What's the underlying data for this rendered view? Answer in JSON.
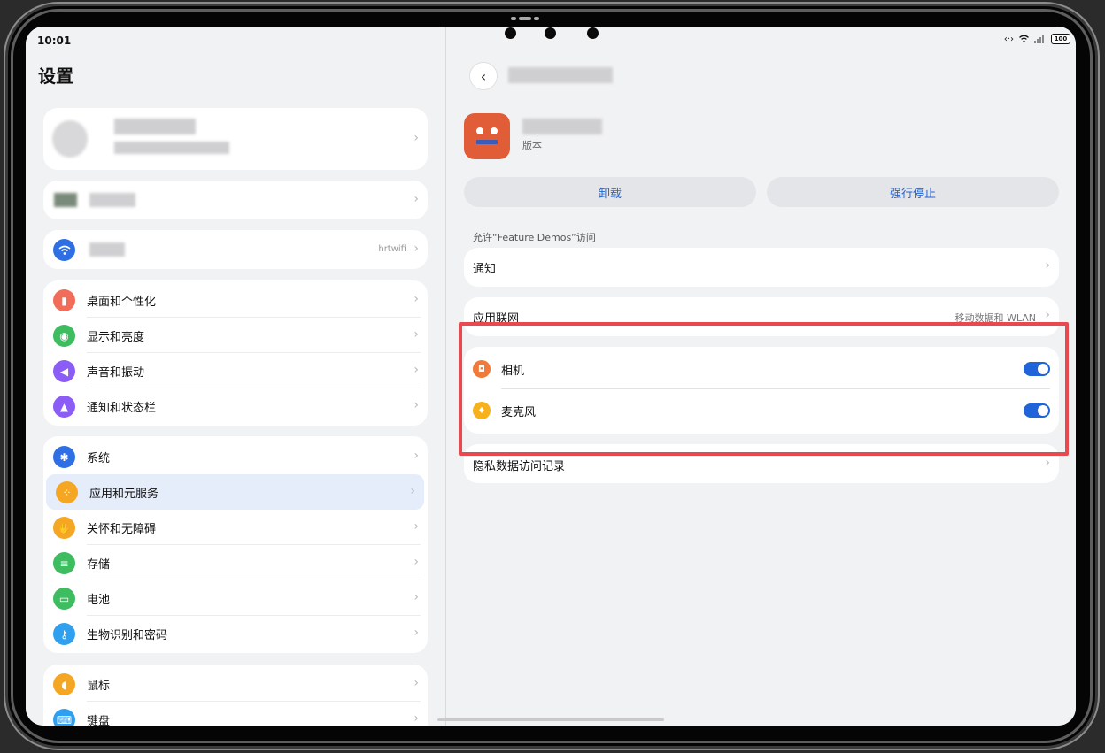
{
  "status": {
    "time": "10:01",
    "battery": "100"
  },
  "settings": {
    "title": "设置",
    "wifi_value": "hrtwifi",
    "groups": [
      [
        {
          "label": "桌面和个性化",
          "icon": "paint-roller-icon",
          "color": "#f26c5a"
        },
        {
          "label": "显示和亮度",
          "icon": "eye-icon",
          "color": "#3dbd5f"
        },
        {
          "label": "声音和振动",
          "icon": "speaker-icon",
          "color": "#8b5cf6"
        },
        {
          "label": "通知和状态栏",
          "icon": "bell-icon",
          "color": "#8b5cf6"
        }
      ],
      [
        {
          "label": "系统",
          "icon": "gear-icon",
          "color": "#2f6fe6"
        },
        {
          "label": "应用和元服务",
          "icon": "apps-grid-icon",
          "color": "#f5a623"
        },
        {
          "label": "关怀和无障碍",
          "icon": "hand-icon",
          "color": "#f5a623"
        },
        {
          "label": "存储",
          "icon": "storage-icon",
          "color": "#3dbd5f"
        },
        {
          "label": "电池",
          "icon": "battery-icon",
          "color": "#3dbd5f"
        },
        {
          "label": "生物识别和密码",
          "icon": "key-icon",
          "color": "#2fa0ef"
        }
      ],
      [
        {
          "label": "鼠标",
          "icon": "mouse-icon",
          "color": "#f5a623"
        },
        {
          "label": "键盘",
          "icon": "keyboard-icon",
          "color": "#2fa0ef"
        }
      ]
    ]
  },
  "app_detail": {
    "version_prefix": "版本",
    "uninstall": "卸载",
    "force_stop": "强行停止",
    "allow_access_label": "允许“Feature Demos”访问",
    "notification": "通知",
    "network": {
      "label": "应用联网",
      "value": "移动数据和 WLAN"
    },
    "permissions": [
      {
        "label": "相机",
        "icon": "camera-icon",
        "color": "#ef7a3a",
        "enabled": true
      },
      {
        "label": "麦克风",
        "icon": "microphone-icon",
        "color": "#f5b21c",
        "enabled": true
      }
    ],
    "privacy_record": "隐私数据访问记录"
  }
}
